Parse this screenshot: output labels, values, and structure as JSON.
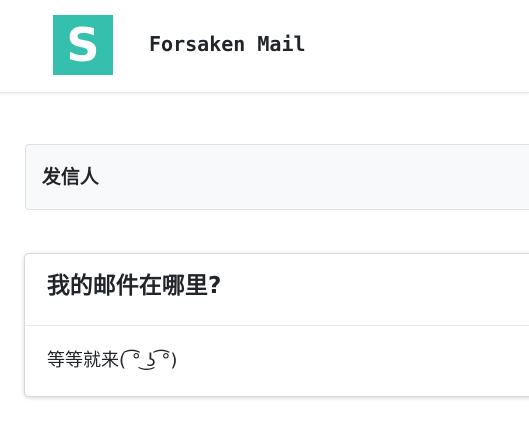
{
  "header": {
    "logo_letter": "S",
    "app_title": "Forsaken Mail",
    "logo_color": "#35bfad"
  },
  "sender": {
    "label": "发信人"
  },
  "mail": {
    "subject": "我的邮件在哪里?",
    "body": "等等就来( ͡° ͜ʖ ͡°)"
  }
}
